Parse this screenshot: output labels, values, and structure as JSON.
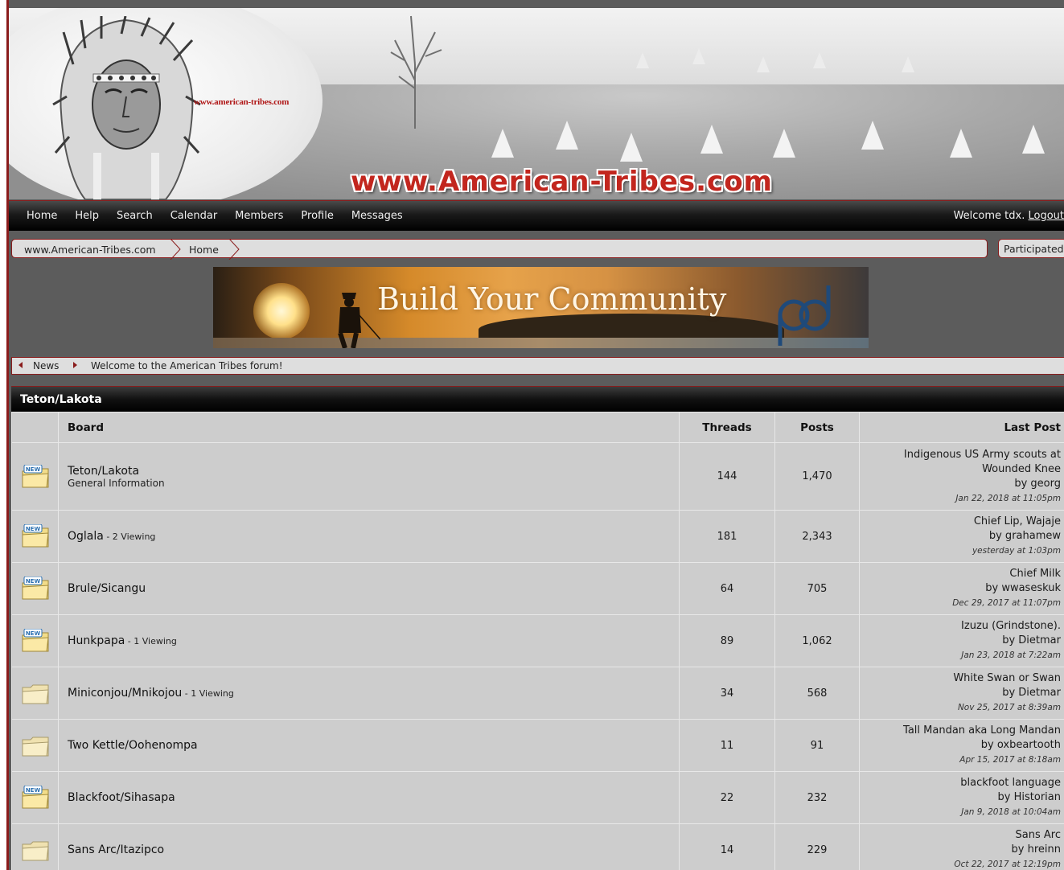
{
  "banner": {
    "site_url": "www.american-tribes.com",
    "title": "www.American-Tribes.com"
  },
  "nav": {
    "items": [
      "Home",
      "Help",
      "Search",
      "Calendar",
      "Members",
      "Profile",
      "Messages"
    ],
    "welcome": "Welcome tdx.",
    "logout": "Logout"
  },
  "breadcrumb": {
    "items": [
      "www.American-Tribes.com",
      "Home"
    ],
    "participated": "Participated"
  },
  "ad": {
    "text": "Build Your Community"
  },
  "news": {
    "label": "News",
    "message": "Welcome to the American Tribes forum!"
  },
  "category": {
    "title": "Teton/Lakota",
    "columns": {
      "board": "Board",
      "threads": "Threads",
      "posts": "Posts",
      "last_post": "Last Post"
    },
    "boards": [
      {
        "name": "Teton/Lakota",
        "description": "General Information",
        "viewing": "",
        "threads": "144",
        "posts": "1,470",
        "new": true,
        "last_title": "Indigenous US Army scouts at Wounded Knee",
        "last_by": "by georg",
        "last_date": "Jan 22, 2018 at 11:05pm"
      },
      {
        "name": "Oglala",
        "description": "",
        "viewing": " - 2 Viewing",
        "threads": "181",
        "posts": "2,343",
        "new": true,
        "last_title": "Chief Lip, Wajaje",
        "last_by": "by grahamew",
        "last_date": "yesterday at 1:03pm"
      },
      {
        "name": "Brule/Sicangu",
        "description": "",
        "viewing": "",
        "threads": "64",
        "posts": "705",
        "new": true,
        "last_title": "Chief Milk",
        "last_by": "by wwaseskuk",
        "last_date": "Dec 29, 2017 at 11:07pm"
      },
      {
        "name": "Hunkpapa",
        "description": "",
        "viewing": " - 1 Viewing",
        "threads": "89",
        "posts": "1,062",
        "new": true,
        "last_title": "Izuzu (Grindstone).",
        "last_by": "by Dietmar",
        "last_date": "Jan 23, 2018 at 7:22am"
      },
      {
        "name": "Miniconjou/Mnikojou",
        "description": "",
        "viewing": " - 1 Viewing",
        "threads": "34",
        "posts": "568",
        "new": false,
        "last_title": "White Swan or Swan",
        "last_by": "by Dietmar",
        "last_date": "Nov 25, 2017 at 8:39am"
      },
      {
        "name": "Two Kettle/Oohenompa",
        "description": "",
        "viewing": "",
        "threads": "11",
        "posts": "91",
        "new": false,
        "last_title": "Tall Mandan aka Long Mandan",
        "last_by": "by oxbeartooth",
        "last_date": "Apr 15, 2017 at 8:18am"
      },
      {
        "name": "Blackfoot/Sihasapa",
        "description": "",
        "viewing": "",
        "threads": "22",
        "posts": "232",
        "new": true,
        "last_title": "blackfoot language",
        "last_by": "by Historian",
        "last_date": "Jan 9, 2018 at 10:04am"
      },
      {
        "name": "Sans Arc/Itazipco",
        "description": "",
        "viewing": "",
        "threads": "14",
        "posts": "229",
        "new": false,
        "last_title": "Sans Arc",
        "last_by": "by hreinn",
        "last_date": "Oct 22, 2017 at 12:19pm"
      }
    ]
  },
  "icons": {
    "folder": "folder-icon",
    "new_badge": "new-badge-icon",
    "accent": "#8a1c1c"
  }
}
